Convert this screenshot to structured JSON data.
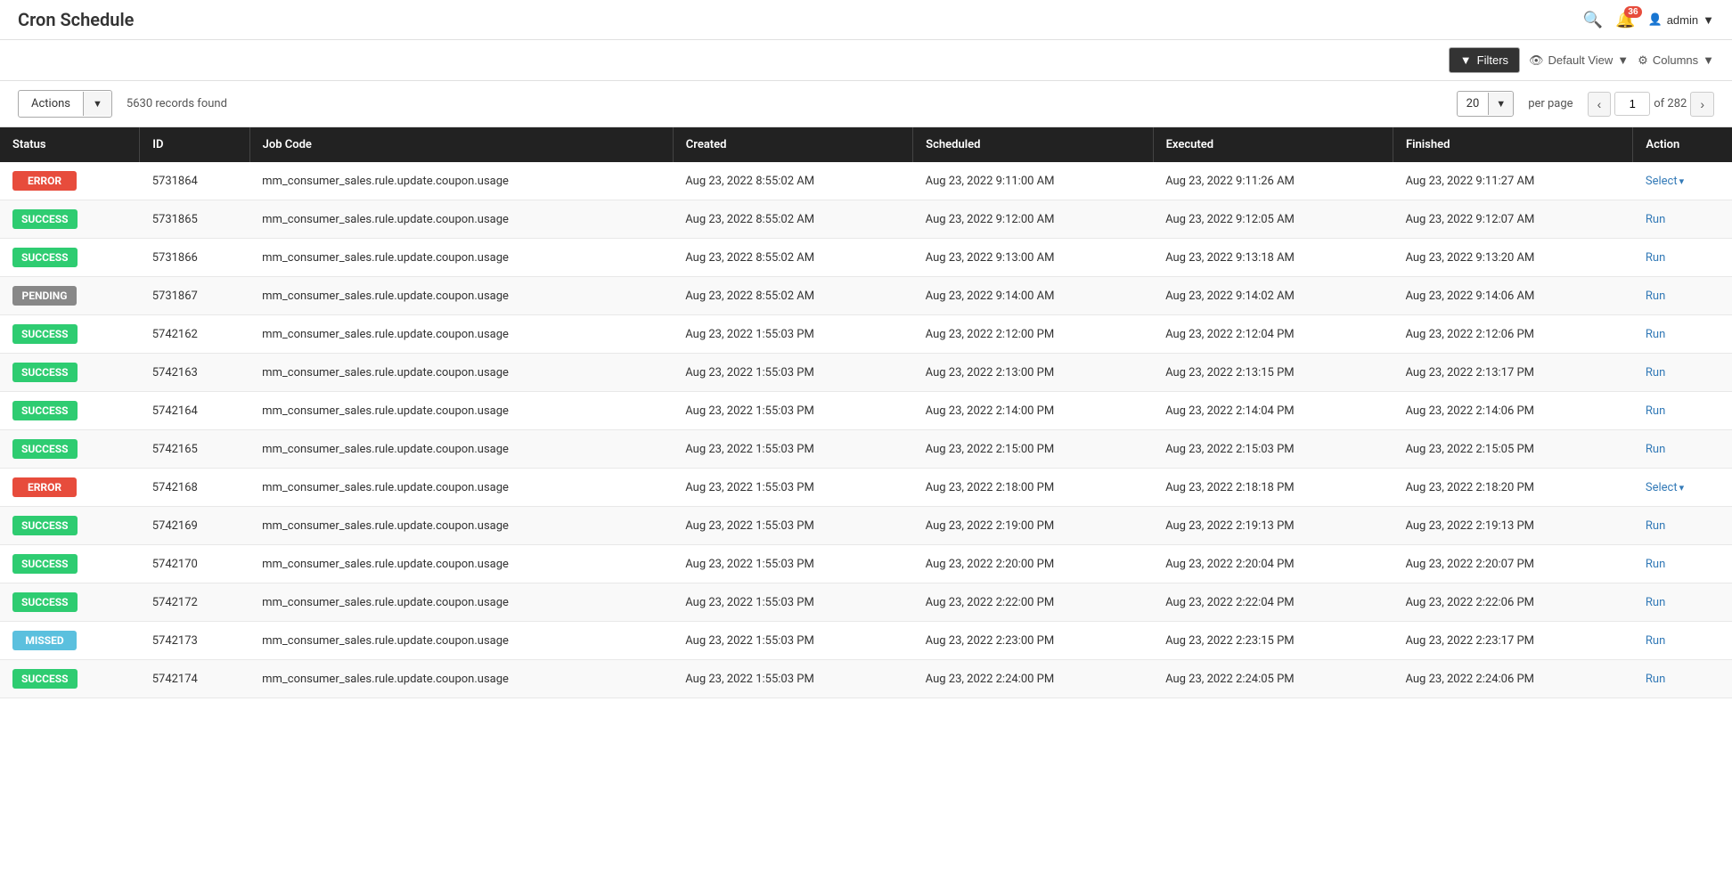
{
  "app": {
    "title": "Cron Schedule"
  },
  "header": {
    "notifications_count": "36",
    "user_label": "admin",
    "user_icon": "▾"
  },
  "toolbar": {
    "filter_label": "Filters",
    "view_label": "Default View",
    "columns_label": "Columns"
  },
  "controls": {
    "actions_label": "Actions",
    "records_found": "5630 records found",
    "per_page_value": "20",
    "per_page_label": "per page",
    "current_page": "1",
    "total_pages": "of 282"
  },
  "table": {
    "columns": [
      "Status",
      "ID",
      "Job Code",
      "Created",
      "Scheduled",
      "Executed",
      "Finished",
      "Action"
    ],
    "rows": [
      {
        "status": "ERROR",
        "status_type": "error",
        "id": "5731864",
        "job_code": "mm_consumer_sales.rule.update.coupon.usage",
        "created": "Aug 23, 2022 8:55:02 AM",
        "scheduled": "Aug 23, 2022 9:11:00 AM",
        "executed": "Aug 23, 2022 9:11:26 AM",
        "finished": "Aug 23, 2022 9:11:27 AM",
        "action": "Select",
        "action_type": "select"
      },
      {
        "status": "SUCCESS",
        "status_type": "success",
        "id": "5731865",
        "job_code": "mm_consumer_sales.rule.update.coupon.usage",
        "created": "Aug 23, 2022 8:55:02 AM",
        "scheduled": "Aug 23, 2022 9:12:00 AM",
        "executed": "Aug 23, 2022 9:12:05 AM",
        "finished": "Aug 23, 2022 9:12:07 AM",
        "action": "Run",
        "action_type": "run"
      },
      {
        "status": "SUCCESS",
        "status_type": "success",
        "id": "5731866",
        "job_code": "mm_consumer_sales.rule.update.coupon.usage",
        "created": "Aug 23, 2022 8:55:02 AM",
        "scheduled": "Aug 23, 2022 9:13:00 AM",
        "executed": "Aug 23, 2022 9:13:18 AM",
        "finished": "Aug 23, 2022 9:13:20 AM",
        "action": "Run",
        "action_type": "run"
      },
      {
        "status": "PENDING",
        "status_type": "pending",
        "id": "5731867",
        "job_code": "mm_consumer_sales.rule.update.coupon.usage",
        "created": "Aug 23, 2022 8:55:02 AM",
        "scheduled": "Aug 23, 2022 9:14:00 AM",
        "executed": "Aug 23, 2022 9:14:02 AM",
        "finished": "Aug 23, 2022 9:14:06 AM",
        "action": "Run",
        "action_type": "run"
      },
      {
        "status": "SUCCESS",
        "status_type": "success",
        "id": "5742162",
        "job_code": "mm_consumer_sales.rule.update.coupon.usage",
        "created": "Aug 23, 2022 1:55:03 PM",
        "scheduled": "Aug 23, 2022 2:12:00 PM",
        "executed": "Aug 23, 2022 2:12:04 PM",
        "finished": "Aug 23, 2022 2:12:06 PM",
        "action": "Run",
        "action_type": "run"
      },
      {
        "status": "SUCCESS",
        "status_type": "success",
        "id": "5742163",
        "job_code": "mm_consumer_sales.rule.update.coupon.usage",
        "created": "Aug 23, 2022 1:55:03 PM",
        "scheduled": "Aug 23, 2022 2:13:00 PM",
        "executed": "Aug 23, 2022 2:13:15 PM",
        "finished": "Aug 23, 2022 2:13:17 PM",
        "action": "Run",
        "action_type": "run"
      },
      {
        "status": "SUCCESS",
        "status_type": "success",
        "id": "5742164",
        "job_code": "mm_consumer_sales.rule.update.coupon.usage",
        "created": "Aug 23, 2022 1:55:03 PM",
        "scheduled": "Aug 23, 2022 2:14:00 PM",
        "executed": "Aug 23, 2022 2:14:04 PM",
        "finished": "Aug 23, 2022 2:14:06 PM",
        "action": "Run",
        "action_type": "run"
      },
      {
        "status": "SUCCESS",
        "status_type": "success",
        "id": "5742165",
        "job_code": "mm_consumer_sales.rule.update.coupon.usage",
        "created": "Aug 23, 2022 1:55:03 PM",
        "scheduled": "Aug 23, 2022 2:15:00 PM",
        "executed": "Aug 23, 2022 2:15:03 PM",
        "finished": "Aug 23, 2022 2:15:05 PM",
        "action": "Run",
        "action_type": "run"
      },
      {
        "status": "ERROR",
        "status_type": "error",
        "id": "5742168",
        "job_code": "mm_consumer_sales.rule.update.coupon.usage",
        "created": "Aug 23, 2022 1:55:03 PM",
        "scheduled": "Aug 23, 2022 2:18:00 PM",
        "executed": "Aug 23, 2022 2:18:18 PM",
        "finished": "Aug 23, 2022 2:18:20 PM",
        "action": "Select",
        "action_type": "select"
      },
      {
        "status": "SUCCESS",
        "status_type": "success",
        "id": "5742169",
        "job_code": "mm_consumer_sales.rule.update.coupon.usage",
        "created": "Aug 23, 2022 1:55:03 PM",
        "scheduled": "Aug 23, 2022 2:19:00 PM",
        "executed": "Aug 23, 2022 2:19:13 PM",
        "finished": "Aug 23, 2022 2:19:13 PM",
        "action": "Run",
        "action_type": "run"
      },
      {
        "status": "SUCCESS",
        "status_type": "success",
        "id": "5742170",
        "job_code": "mm_consumer_sales.rule.update.coupon.usage",
        "created": "Aug 23, 2022 1:55:03 PM",
        "scheduled": "Aug 23, 2022 2:20:00 PM",
        "executed": "Aug 23, 2022 2:20:04 PM",
        "finished": "Aug 23, 2022 2:20:07 PM",
        "action": "Run",
        "action_type": "run"
      },
      {
        "status": "SUCCESS",
        "status_type": "success",
        "id": "5742172",
        "job_code": "mm_consumer_sales.rule.update.coupon.usage",
        "created": "Aug 23, 2022 1:55:03 PM",
        "scheduled": "Aug 23, 2022 2:22:00 PM",
        "executed": "Aug 23, 2022 2:22:04 PM",
        "finished": "Aug 23, 2022 2:22:06 PM",
        "action": "Run",
        "action_type": "run"
      },
      {
        "status": "MISSED",
        "status_type": "missed",
        "id": "5742173",
        "job_code": "mm_consumer_sales.rule.update.coupon.usage",
        "created": "Aug 23, 2022 1:55:03 PM",
        "scheduled": "Aug 23, 2022 2:23:00 PM",
        "executed": "Aug 23, 2022 2:23:15 PM",
        "finished": "Aug 23, 2022 2:23:17 PM",
        "action": "Run",
        "action_type": "run"
      },
      {
        "status": "SUCCESS",
        "status_type": "success",
        "id": "5742174",
        "job_code": "mm_consumer_sales.rule.update.coupon.usage",
        "created": "Aug 23, 2022 1:55:03 PM",
        "scheduled": "Aug 23, 2022 2:24:00 PM",
        "executed": "Aug 23, 2022 2:24:05 PM",
        "finished": "Aug 23, 2022 2:24:06 PM",
        "action": "Run",
        "action_type": "run"
      }
    ]
  }
}
